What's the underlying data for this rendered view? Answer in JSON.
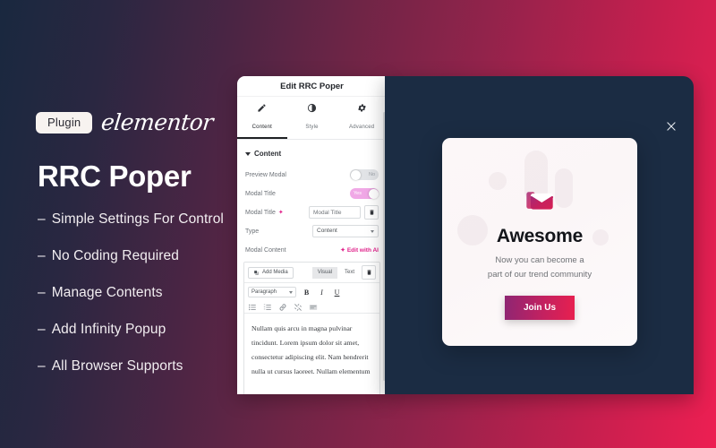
{
  "theme": {
    "bg_gradient_start": "#19283f",
    "bg_gradient_mid": "#92234b",
    "bg_gradient_end": "#ed1f52",
    "dark_panel": "#1b2c43",
    "accent_pink": "#e0218a",
    "accent_crimson": "#e8204f"
  },
  "promo": {
    "plugin_chip": "Plugin",
    "brand": "elementor",
    "title": "RRC Poper",
    "features": [
      "Simple Settings For Control",
      "No Coding Required",
      "Manage Contents",
      "Add Infinity Popup",
      "All Browser Supports"
    ],
    "bullet_dash": "–"
  },
  "editor": {
    "header_title": "Edit RRC Poper",
    "tabs": [
      {
        "label": "Content",
        "icon": "pencil-icon",
        "active": true
      },
      {
        "label": "Style",
        "icon": "contrast-icon",
        "active": false
      },
      {
        "label": "Advanced",
        "icon": "gear-icon",
        "active": false
      }
    ],
    "section_title": "Content",
    "controls": {
      "preview_modal_label": "Preview Modal",
      "preview_modal_value": "No",
      "modal_title_toggle_label": "Modal Title",
      "modal_title_toggle_value": "Yes",
      "modal_title_field_label": "Modal Title",
      "modal_title_field_value": "Modal Title",
      "type_label": "Type",
      "type_value": "Content",
      "modal_content_label": "Modal Content",
      "edit_with_ai": "Edit with AI"
    },
    "wp": {
      "add_media": "Add Media",
      "visual_tab": "Visual",
      "text_tab": "Text",
      "format_select": "Paragraph",
      "bold": "B",
      "italic": "I",
      "underline": "U",
      "body_text": "Nullam quis arcu in magna pulvinar tincidunt. Lorem ipsum dolor sit amet, consectetur adipiscing elit. Nam hendrerit nulla ut cursus laoreet. Nullam elementum"
    }
  },
  "preview": {
    "close_label": "×",
    "popup": {
      "icon": "open-envelope-icon",
      "title": "Awesome",
      "subtitle_line1": "Now you can become a",
      "subtitle_line2": "part of our trend community",
      "button_label": "Join Us"
    }
  }
}
